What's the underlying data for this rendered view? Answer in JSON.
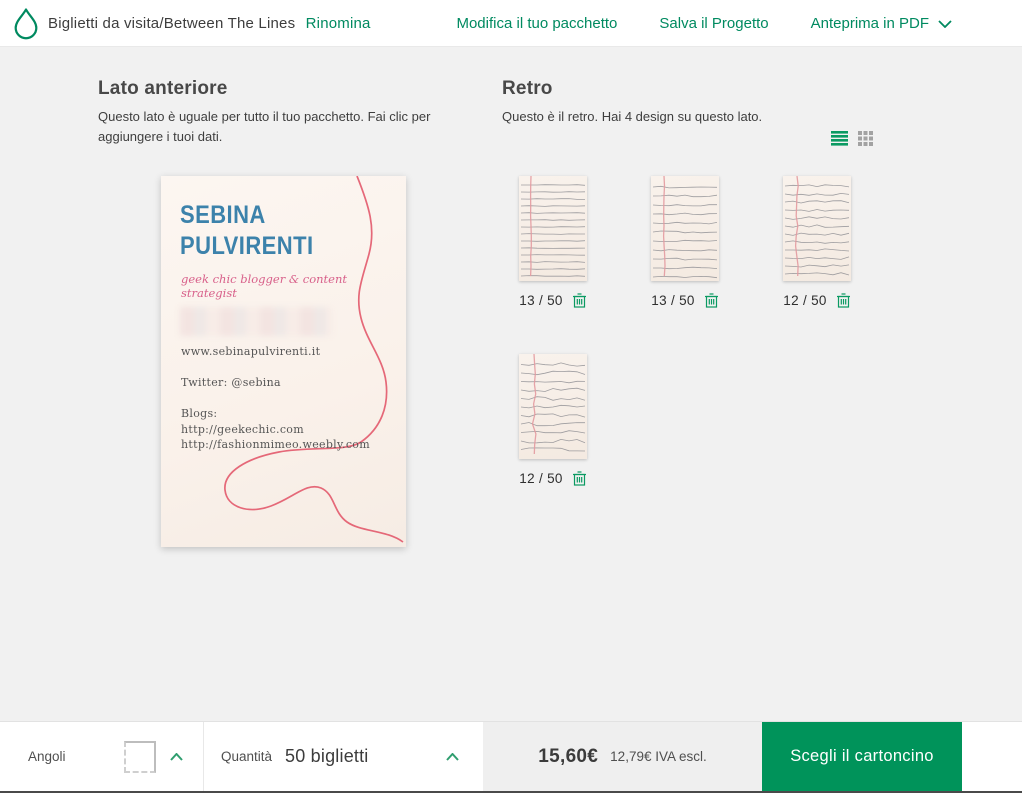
{
  "header": {
    "breadcrumb": {
      "prefix": "Biglietti da visita/",
      "project": "Between The Lines",
      "rename": "Rinomina"
    },
    "nav": {
      "edit_pack": "Modifica il tuo pacchetto",
      "save_project": "Salva il Progetto",
      "pdf_preview": "Anteprima in PDF"
    }
  },
  "front": {
    "title": "Lato anteriore",
    "description": "Questo lato è uguale per tutto il tuo pacchetto. Fai clic per aggiungere i tuoi dati.",
    "card": {
      "name_line1": "SEBINA",
      "name_line2": "PULVIRENTI",
      "tagline": "geek chic blogger & content strategist",
      "website": "www.sebinapulvirenti.it",
      "twitter": "Twitter: @sebina",
      "blogs_label": "Blogs:",
      "blog_urls": [
        "http://geekechic.com",
        "http://fashionmimeo.weebly.com"
      ]
    }
  },
  "back": {
    "title": "Retro",
    "description": "Questo è il retro. Hai 4 design su questo lato.",
    "designs": [
      {
        "count": "13 / 50"
      },
      {
        "count": "13 / 50"
      },
      {
        "count": "12 / 50"
      },
      {
        "count": "12 / 50"
      }
    ]
  },
  "footer": {
    "corners_label": "Angoli",
    "quantity_label": "Quantità",
    "quantity_value": "50 biglietti",
    "price_total": "15,60€",
    "price_net": "12,79€ IVA escl.",
    "cta": "Scegli il cartoncino"
  },
  "colors": {
    "brand_green": "#008a60",
    "cta_green": "#00935a",
    "card_name_blue": "#3c82ab",
    "tagline_pink": "#d8608a",
    "thread_red": "#e2596b",
    "paper_line_gray": "#8e8e93",
    "paper_margin_red": "#e39aa0"
  }
}
